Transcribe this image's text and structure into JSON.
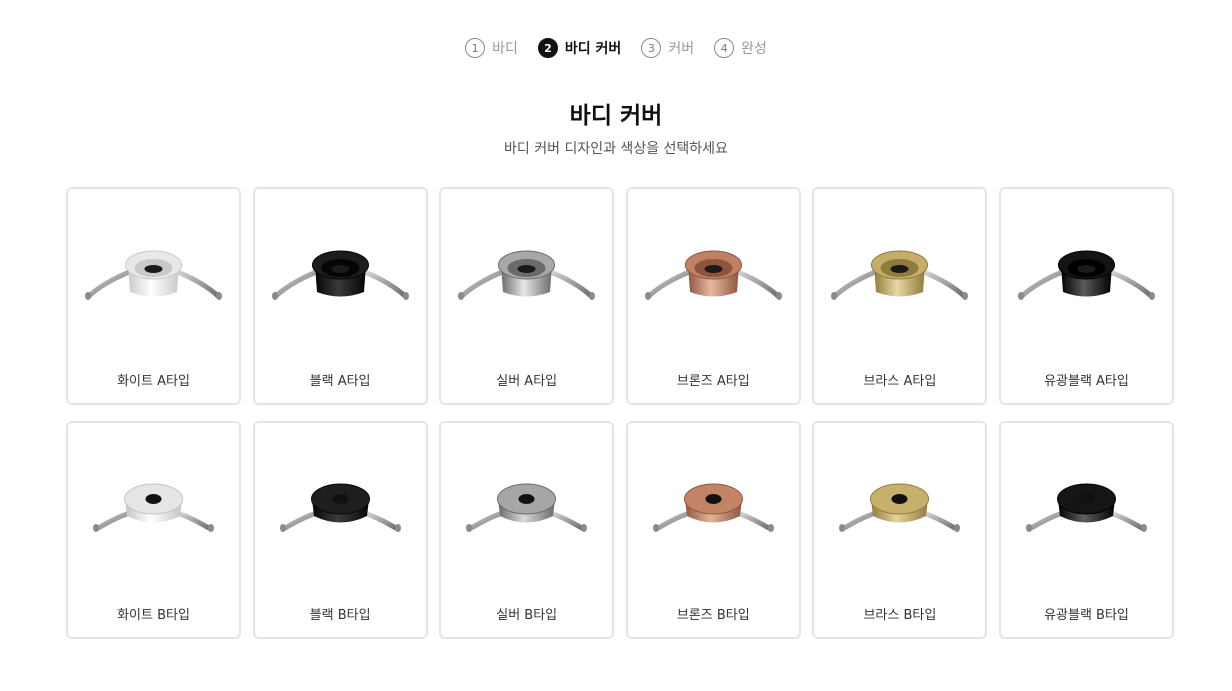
{
  "stepper": {
    "steps": [
      {
        "num": "1",
        "label": "바디",
        "active": false
      },
      {
        "num": "2",
        "label": "바디 커버",
        "active": true
      },
      {
        "num": "3",
        "label": "커버",
        "active": false
      },
      {
        "num": "4",
        "label": "완성",
        "active": false
      }
    ]
  },
  "header": {
    "title": "바디 커버",
    "subtitle": "바디 커버 디자인과 색상을 선택하세요"
  },
  "options": [
    {
      "label": "화이트 A타입",
      "type": "A",
      "color": "#e8e8e8",
      "dark": "#c9c9c9",
      "light": "#ffffff"
    },
    {
      "label": "블랙 A타입",
      "type": "A",
      "color": "#1c1c1c",
      "dark": "#050505",
      "light": "#3a3a3a"
    },
    {
      "label": "실버 A타입",
      "type": "A",
      "color": "#a8a8a8",
      "dark": "#6b6b6b",
      "light": "#e6e6e6"
    },
    {
      "label": "브론즈 A타입",
      "type": "A",
      "color": "#c08063",
      "dark": "#8e553c",
      "light": "#e7b9a2"
    },
    {
      "label": "브라스 A타입",
      "type": "A",
      "color": "#c4ad68",
      "dark": "#8f7b3d",
      "light": "#e6d8a5"
    },
    {
      "label": "유광블랙 A타입",
      "type": "A",
      "color": "#141414",
      "dark": "#000000",
      "light": "#5a5a5a"
    },
    {
      "label": "화이트 B타입",
      "type": "B",
      "color": "#e6e6e6",
      "dark": "#c4c4c4",
      "light": "#ffffff"
    },
    {
      "label": "블랙 B타입",
      "type": "B",
      "color": "#1e1e1e",
      "dark": "#060606",
      "light": "#3c3c3c"
    },
    {
      "label": "실버 B타입",
      "type": "B",
      "color": "#a6a6a6",
      "dark": "#6a6a6a",
      "light": "#d9d9d9"
    },
    {
      "label": "브론즈 B타입",
      "type": "B",
      "color": "#c38466",
      "dark": "#8f573e",
      "light": "#e3b29a"
    },
    {
      "label": "브라스 B타입",
      "type": "B",
      "color": "#c7b06b",
      "dark": "#917c3e",
      "light": "#e2d29c"
    },
    {
      "label": "유광블랙 B타입",
      "type": "B",
      "color": "#151515",
      "dark": "#000000",
      "light": "#606060"
    }
  ]
}
